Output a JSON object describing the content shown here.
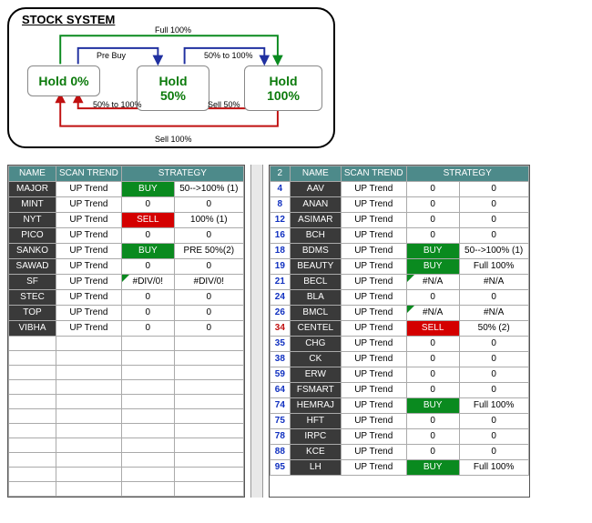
{
  "diagram": {
    "title": "STOCK SYSTEM",
    "state0": "Hold 0%",
    "state50": "Hold 50%",
    "state100": "Hold 100%",
    "labels": {
      "full": "Full 100%",
      "prebuy": "Pre Buy",
      "fiftyTo100a": "50% to 100%",
      "fiftyTo100b": "50% to 100%",
      "sell50": "Sell 50%",
      "sell100": "Sell 100%"
    }
  },
  "left": {
    "headers": {
      "name": "NAME",
      "trend": "SCAN TREND",
      "strategy": "STRATEGY"
    },
    "rows": [
      {
        "name": "MAJOR",
        "trend": "UP Trend",
        "sig": "BUY",
        "sigClass": "sig-buy",
        "s2": "50-->100% (1)"
      },
      {
        "name": "MINT",
        "trend": "UP Trend",
        "sig": "0",
        "sigClass": "",
        "s2": "0"
      },
      {
        "name": "NYT",
        "trend": "UP Trend",
        "sig": "SELL",
        "sigClass": "sig-sell",
        "s2": "100% (1)"
      },
      {
        "name": "PICO",
        "trend": "UP Trend",
        "sig": "0",
        "sigClass": "",
        "s2": "0"
      },
      {
        "name": "SANKO",
        "trend": "UP Trend",
        "sig": "BUY",
        "sigClass": "sig-buy",
        "s2": "PRE 50%(2)"
      },
      {
        "name": "SAWAD",
        "trend": "UP Trend",
        "sig": "0",
        "sigClass": "",
        "s2": "0"
      },
      {
        "name": "SF",
        "trend": "UP Trend",
        "sig": "#DIV/0!",
        "sigClass": "flag-cell",
        "s2": "#DIV/0!"
      },
      {
        "name": "STEC",
        "trend": "UP Trend",
        "sig": "0",
        "sigClass": "",
        "s2": "0"
      },
      {
        "name": "TOP",
        "trend": "UP Trend",
        "sig": "0",
        "sigClass": "",
        "s2": "0"
      },
      {
        "name": "VIBHA",
        "trend": "UP Trend",
        "sig": "0",
        "sigClass": "",
        "s2": "0"
      }
    ],
    "emptyRows": 11
  },
  "right": {
    "headers": {
      "num": "2",
      "name": "NAME",
      "trend": "SCAN TREND",
      "strategy": "STRATEGY"
    },
    "rows": [
      {
        "id": "4",
        "idClass": "blue-id",
        "name": "AAV",
        "trend": "UP Trend",
        "sig": "0",
        "sigClass": "",
        "s2": "0"
      },
      {
        "id": "8",
        "idClass": "blue-id",
        "name": "ANAN",
        "trend": "UP Trend",
        "sig": "0",
        "sigClass": "",
        "s2": "0"
      },
      {
        "id": "12",
        "idClass": "blue-id",
        "name": "ASIMAR",
        "trend": "UP Trend",
        "sig": "0",
        "sigClass": "",
        "s2": "0"
      },
      {
        "id": "16",
        "idClass": "blue-id",
        "name": "BCH",
        "trend": "UP Trend",
        "sig": "0",
        "sigClass": "",
        "s2": "0"
      },
      {
        "id": "18",
        "idClass": "blue-id",
        "name": "BDMS",
        "trend": "UP Trend",
        "sig": "BUY",
        "sigClass": "sig-buy",
        "s2": "50-->100% (1)"
      },
      {
        "id": "19",
        "idClass": "blue-id",
        "name": "BEAUTY",
        "trend": "UP Trend",
        "sig": "BUY",
        "sigClass": "sig-buy",
        "s2": "Full 100%"
      },
      {
        "id": "21",
        "idClass": "blue-id",
        "name": "BECL",
        "trend": "UP Trend",
        "sig": "#N/A",
        "sigClass": "flag-cell",
        "s2": "#N/A"
      },
      {
        "id": "24",
        "idClass": "blue-id",
        "name": "BLA",
        "trend": "UP Trend",
        "sig": "0",
        "sigClass": "",
        "s2": "0"
      },
      {
        "id": "26",
        "idClass": "blue-id",
        "name": "BMCL",
        "trend": "UP Trend",
        "sig": "#N/A",
        "sigClass": "flag-cell",
        "s2": "#N/A"
      },
      {
        "id": "34",
        "idClass": "red-id",
        "name": "CENTEL",
        "trend": "UP Trend",
        "sig": "SELL",
        "sigClass": "sig-sell",
        "s2": "50% (2)"
      },
      {
        "id": "35",
        "idClass": "blue-id",
        "name": "CHG",
        "trend": "UP Trend",
        "sig": "0",
        "sigClass": "",
        "s2": "0"
      },
      {
        "id": "38",
        "idClass": "blue-id",
        "name": "CK",
        "trend": "UP Trend",
        "sig": "0",
        "sigClass": "",
        "s2": "0"
      },
      {
        "id": "59",
        "idClass": "blue-id",
        "name": "ERW",
        "trend": "UP Trend",
        "sig": "0",
        "sigClass": "",
        "s2": "0"
      },
      {
        "id": "64",
        "idClass": "blue-id",
        "name": "FSMART",
        "trend": "UP Trend",
        "sig": "0",
        "sigClass": "",
        "s2": "0"
      },
      {
        "id": "74",
        "idClass": "blue-id",
        "name": "HEMRAJ",
        "trend": "UP Trend",
        "sig": "BUY",
        "sigClass": "sig-buy",
        "s2": "Full 100%"
      },
      {
        "id": "75",
        "idClass": "blue-id",
        "name": "HFT",
        "trend": "UP Trend",
        "sig": "0",
        "sigClass": "",
        "s2": "0"
      },
      {
        "id": "78",
        "idClass": "blue-id",
        "name": "IRPC",
        "trend": "UP Trend",
        "sig": "0",
        "sigClass": "",
        "s2": "0"
      },
      {
        "id": "88",
        "idClass": "blue-id",
        "name": "KCE",
        "trend": "UP Trend",
        "sig": "0",
        "sigClass": "",
        "s2": "0"
      },
      {
        "id": "95",
        "idClass": "blue-id",
        "name": "LH",
        "trend": "UP Trend",
        "sig": "BUY",
        "sigClass": "sig-buy",
        "s2": "Full 100%"
      }
    ]
  }
}
